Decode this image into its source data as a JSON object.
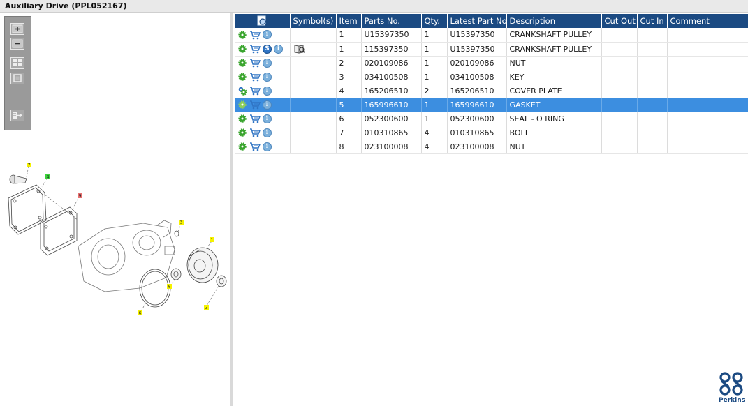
{
  "window": {
    "title": "Auxiliary Drive (PPL052167)"
  },
  "toolbar": {
    "buttons": [
      {
        "icon": "zoom-in-icon"
      },
      {
        "icon": "zoom-out-icon"
      },
      {
        "icon": "fit-grid-icon"
      },
      {
        "icon": "fit-window-icon"
      },
      {
        "icon": "export-icon"
      }
    ]
  },
  "diagram": {
    "callouts": [
      "7",
      "4",
      "9",
      "3",
      "1",
      "8",
      "6",
      "2"
    ]
  },
  "table": {
    "headers": {
      "actions_icon": "search-list-icon",
      "symbols": "Symbol(s)",
      "item": "Item",
      "parts_no": "Parts No.",
      "qty": "Qty.",
      "latest_part_no": "Latest Part No.",
      "description": "Description",
      "cut_out": "Cut Out",
      "cut_in": "Cut In",
      "comment": "Comment"
    },
    "rows": [
      {
        "item": "1",
        "parts_no": "U15397350",
        "qty": "1",
        "latest": "U15397350",
        "description": "CRANKSHAFT PULLEY",
        "symbol": "",
        "has_s": false,
        "selected": false
      },
      {
        "item": "1",
        "parts_no": "115397350",
        "qty": "1",
        "latest": "U15397350",
        "description": "CRANKSHAFT PULLEY",
        "symbol": "book-icon",
        "has_s": true,
        "s_label": "S",
        "selected": false
      },
      {
        "item": "2",
        "parts_no": "020109086",
        "qty": "1",
        "latest": "020109086",
        "description": "NUT",
        "symbol": "",
        "has_s": false,
        "selected": false
      },
      {
        "item": "3",
        "parts_no": "034100508",
        "qty": "1",
        "latest": "034100508",
        "description": "KEY",
        "symbol": "",
        "has_s": false,
        "selected": false
      },
      {
        "item": "4",
        "parts_no": "165206510",
        "qty": "2",
        "latest": "165206510",
        "description": "COVER PLATE",
        "symbol": "",
        "has_s": false,
        "selected": false
      },
      {
        "item": "5",
        "parts_no": "165996610",
        "qty": "1",
        "latest": "165996610",
        "description": "GASKET",
        "symbol": "",
        "has_s": false,
        "selected": true
      },
      {
        "item": "6",
        "parts_no": "052300600",
        "qty": "1",
        "latest": "052300600",
        "description": "SEAL - O RING",
        "symbol": "",
        "has_s": false,
        "selected": false
      },
      {
        "item": "7",
        "parts_no": "010310865",
        "qty": "4",
        "latest": "010310865",
        "description": "BOLT",
        "symbol": "",
        "has_s": false,
        "selected": false
      },
      {
        "item": "8",
        "parts_no": "023100008",
        "qty": "4",
        "latest": "023100008",
        "description": "NUT",
        "symbol": "",
        "has_s": false,
        "selected": false
      }
    ],
    "info_label": "i"
  },
  "brand": {
    "name": "Perkins",
    "color": "#1b4a82"
  },
  "colors": {
    "header_bg": "#1b4a82",
    "selected_row": "#3c8ee0",
    "gear_green": "#3aa52e",
    "cart_blue": "#2f74c4"
  }
}
